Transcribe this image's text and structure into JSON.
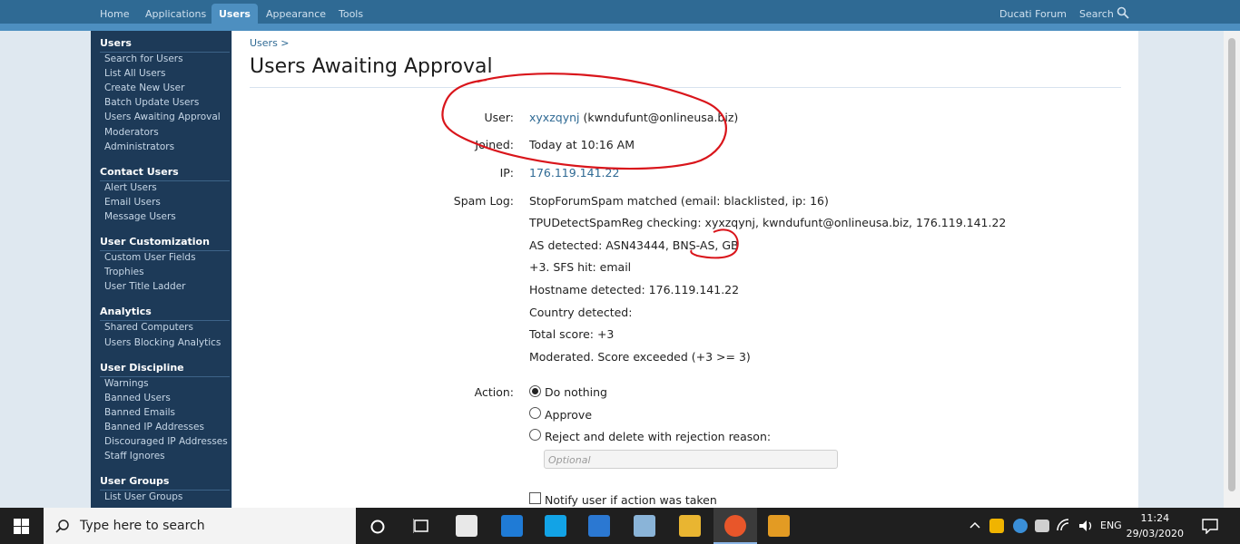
{
  "topnav": {
    "tabs": [
      "Home",
      "Applications",
      "Users",
      "Appearance",
      "Tools"
    ],
    "active": "Users",
    "forum": "Ducati Forum",
    "search": "Search"
  },
  "sidebar": {
    "groups": [
      {
        "title": "Users",
        "items": [
          "Search for Users",
          "List All Users",
          "Create New User",
          "Batch Update Users",
          "Users Awaiting Approval",
          "Moderators",
          "Administrators"
        ]
      },
      {
        "title": "Contact Users",
        "items": [
          "Alert Users",
          "Email Users",
          "Message Users"
        ]
      },
      {
        "title": "User Customization",
        "items": [
          "Custom User Fields",
          "Trophies",
          "User Title Ladder"
        ]
      },
      {
        "title": "Analytics",
        "items": [
          "Shared Computers",
          "Users Blocking Analytics"
        ]
      },
      {
        "title": "User Discipline",
        "items": [
          "Warnings",
          "Banned Users",
          "Banned Emails",
          "Banned IP Addresses",
          "Discouraged IP Addresses",
          "Staff Ignores"
        ]
      },
      {
        "title": "User Groups",
        "items": [
          "List User Groups"
        ]
      }
    ]
  },
  "main": {
    "breadcrumb": "Users >",
    "title": "Users Awaiting Approval",
    "user_label": "User:",
    "username": "xyxzqynj",
    "email": "(kwndufunt@onlineusa.biz)",
    "joined_label": "Joined:",
    "joined": "Today at 10:16 AM",
    "ip_label": "IP:",
    "ip": "176.119.141.22",
    "spam_label": "Spam Log:",
    "spam_log": [
      "StopForumSpam matched (email: blacklisted, ip: 16)",
      "TPUDetectSpamReg checking: xyxzqynj, kwndufunt@onlineusa.biz, 176.119.141.22",
      "AS detected: ASN43444, BNS-AS, GB",
      "+3. SFS hit: email",
      "Hostname detected: 176.119.141.22",
      "Country detected:",
      "Total score: +3",
      "Moderated. Score exceeded (+3 >= 3)"
    ],
    "action_label": "Action:",
    "actions": [
      "Do nothing",
      "Approve",
      "Reject and delete with rejection reason:"
    ],
    "selected_action": "Do nothing",
    "reason_placeholder": "Optional",
    "notify_label": "Notify user if action was taken"
  },
  "taskbar": {
    "search_text": "Type here to search",
    "lang": "ENG",
    "time": "11:24",
    "date": "29/03/2020"
  },
  "colors": {
    "nav": "#2f6a94",
    "sidebar": "#1d3a58",
    "link": "#2f6a94",
    "annotation": "#d9151b"
  }
}
